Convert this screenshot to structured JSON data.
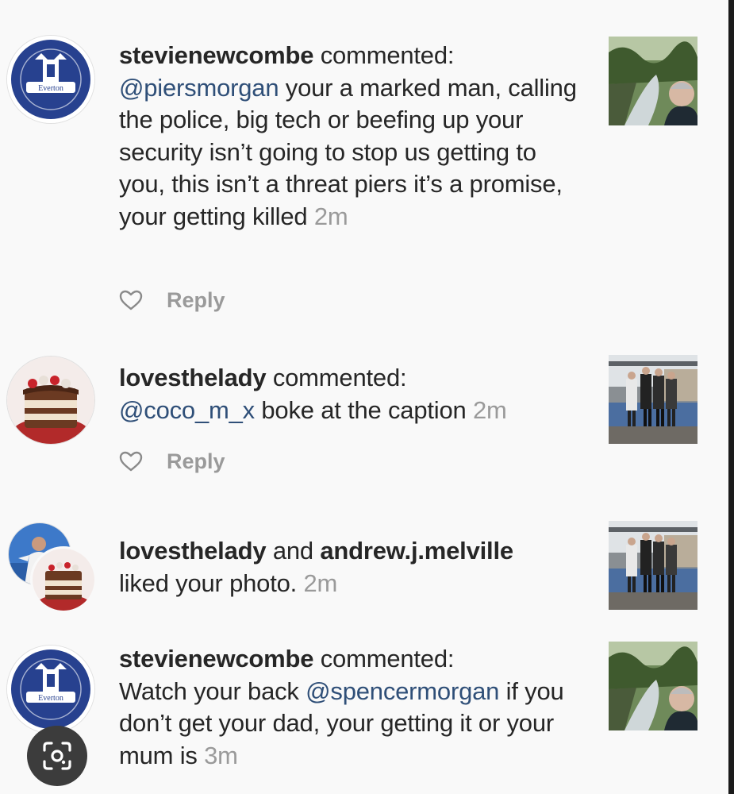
{
  "notifications": [
    {
      "username": "stevienewcombe",
      "action": " commented:",
      "mention": "@piersmorgan",
      "body": " your a marked man, calling the police, big tech or beefing up your security isn’t going to stop us getting to you, this isn’t a threat piers it’s a promise, your getting killed",
      "time": "2m",
      "reply_label": "Reply",
      "avatar_icon": "everton-crest-avatar",
      "thumbnail": "selfie-by-river-thumbnail"
    },
    {
      "username": "lovesthelady",
      "action": " commented:",
      "mention": "@coco_m_x",
      "body": " boke at the caption",
      "time": "2m",
      "reply_label": "Reply",
      "avatar_icon": "cake-avatar",
      "thumbnail": "group-photo-thumbnail"
    },
    {
      "username_1": "lovesthelady",
      "connector": " and ",
      "username_2": "andrew.j.melville",
      "body": "liked your photo.",
      "time": "2m",
      "avatar_icon": "stacked-avatars",
      "thumbnail": "group-photo-thumbnail"
    },
    {
      "username": "stevienewcombe",
      "action": " commented:",
      "prefix": "Watch your back ",
      "mention": "@spencermorgan",
      "body": " if you don’t get your dad, your getting it or your mum is",
      "time": "3m",
      "avatar_icon": "everton-crest-avatar",
      "thumbnail": "selfie-by-river-thumbnail"
    }
  ],
  "colors": {
    "mention": "#2f4f78",
    "everton_blue": "#27418f",
    "timestamp": "#9a9a9a"
  },
  "overlay": {
    "icon": "lens-search-icon"
  }
}
